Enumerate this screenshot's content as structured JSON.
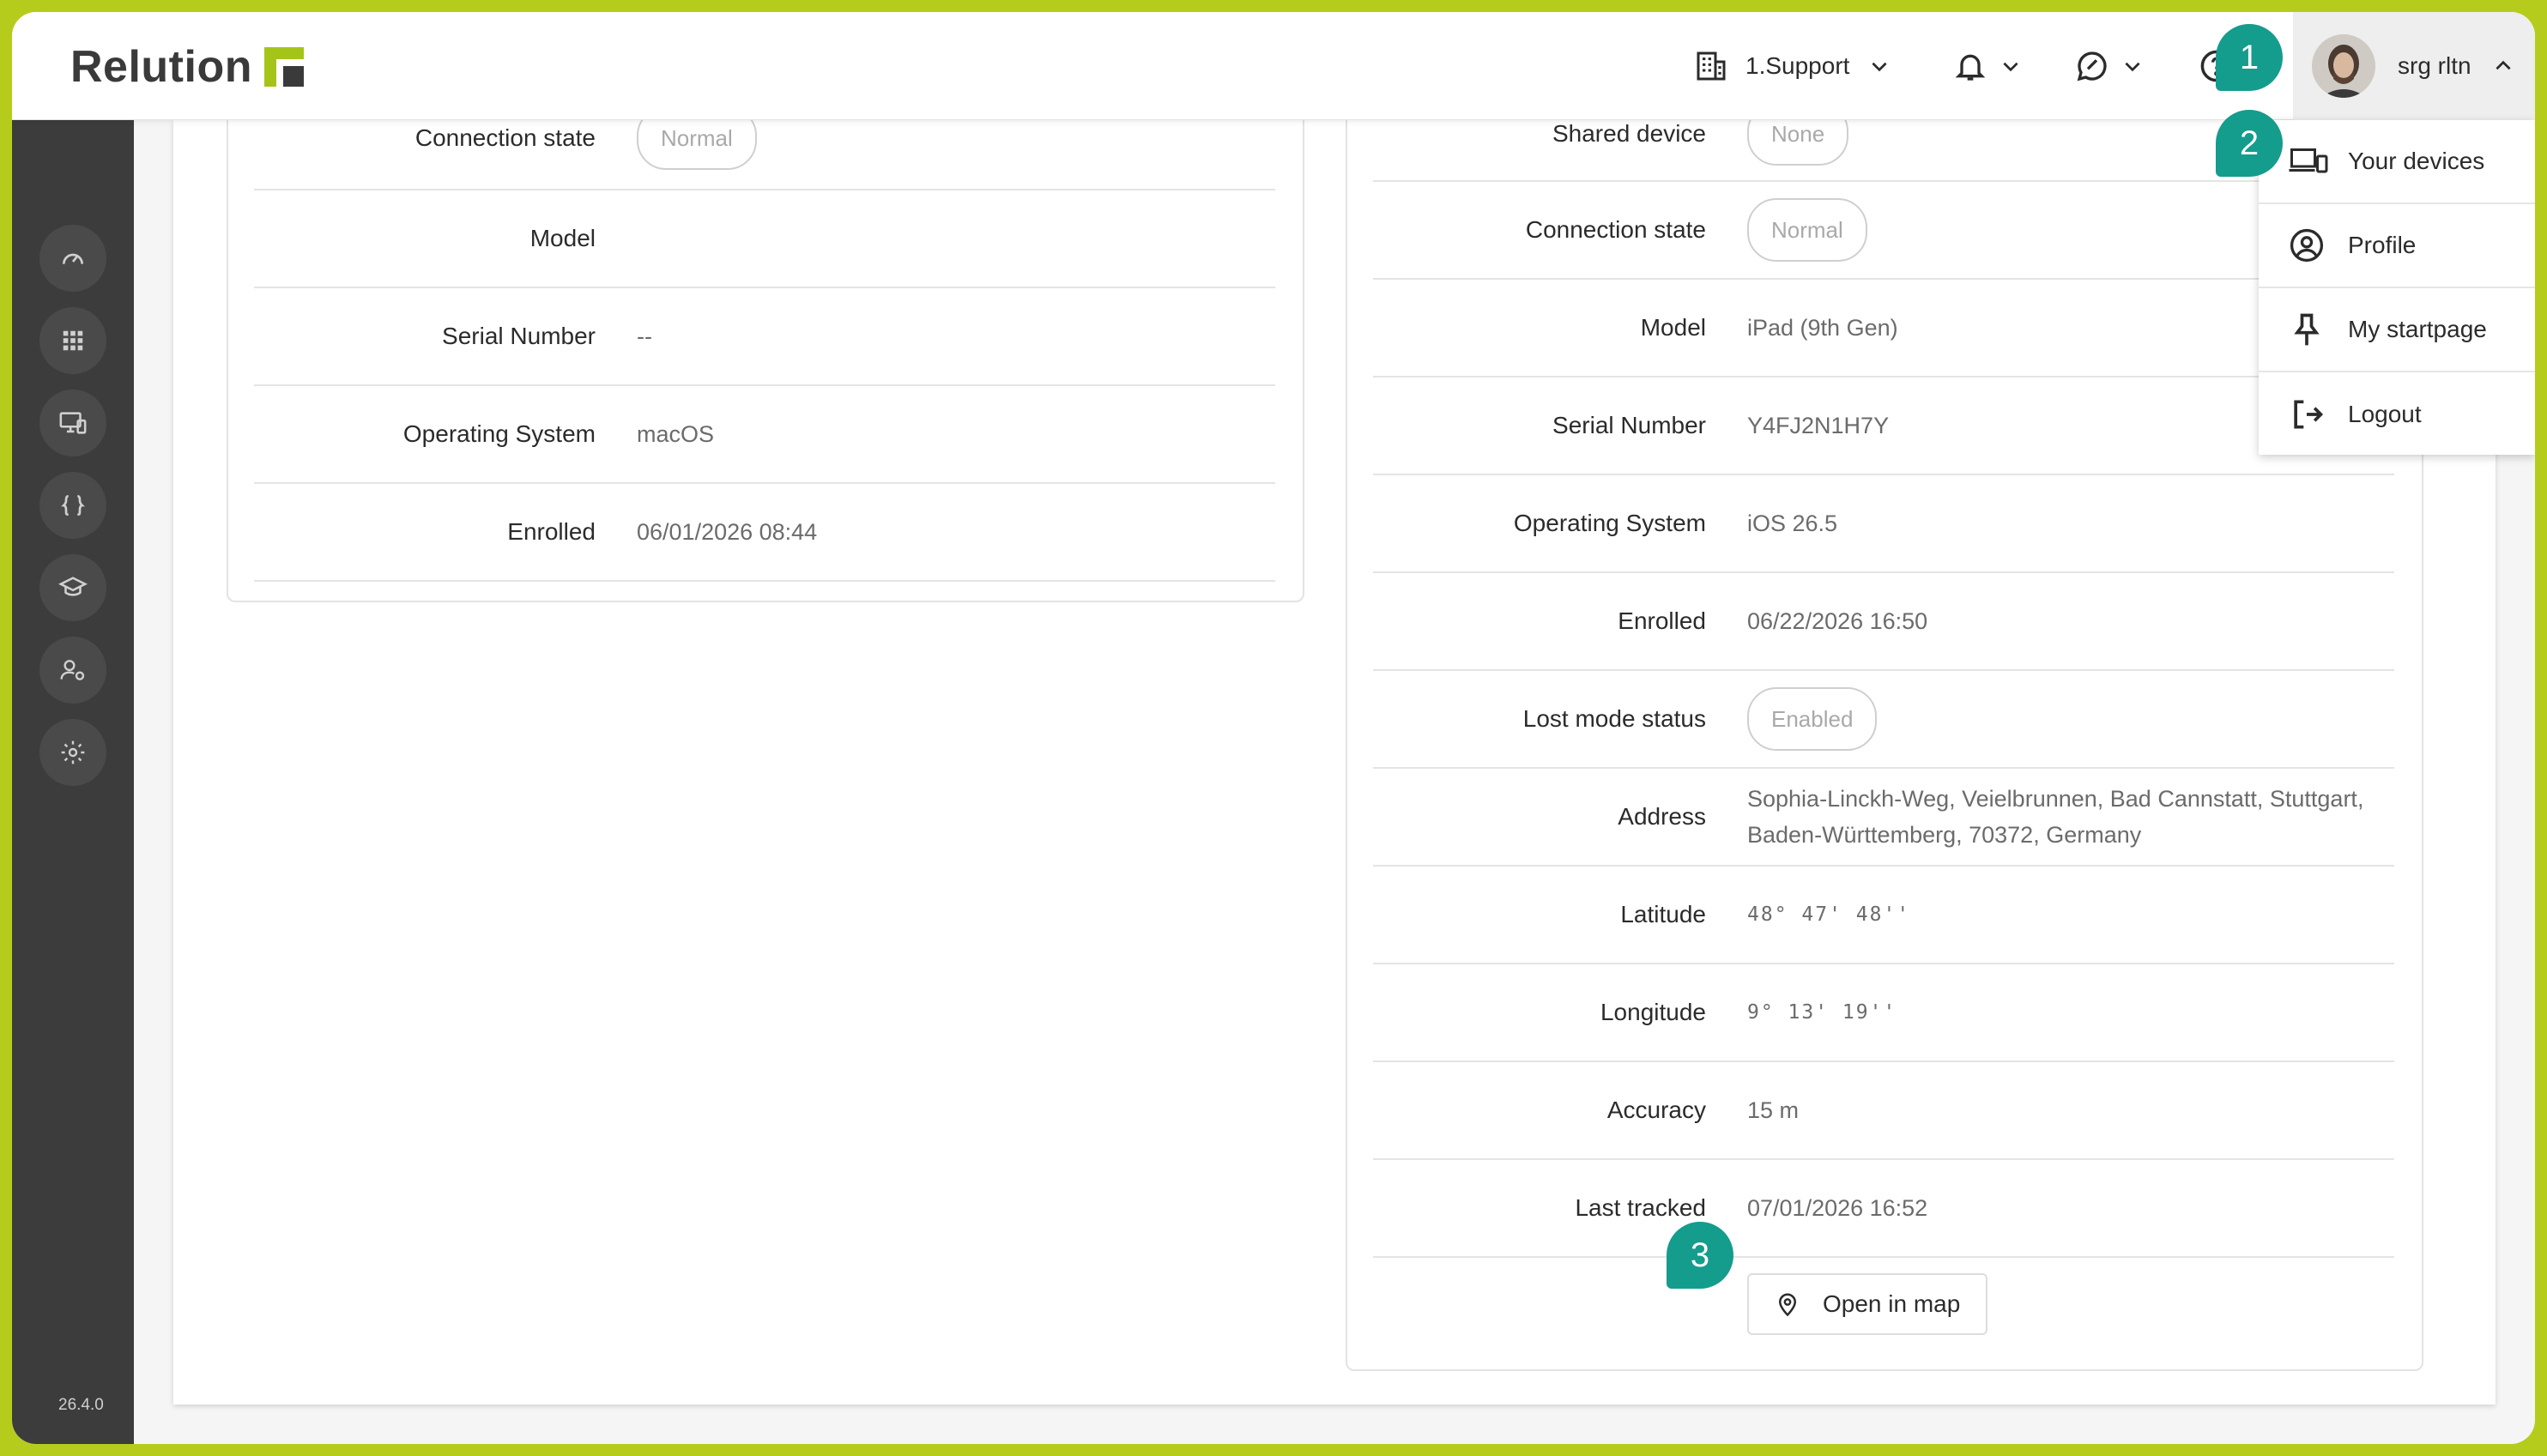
{
  "app": {
    "logo_text": "Relution",
    "version": "26.4.0"
  },
  "header": {
    "organization": "1.Support",
    "user_name": "srg rltn"
  },
  "user_menu": {
    "items": [
      {
        "label": "Your devices",
        "icon": "devices-icon"
      },
      {
        "label": "Profile",
        "icon": "user-circle-icon"
      },
      {
        "label": "My startpage",
        "icon": "pin-icon"
      },
      {
        "label": "Logout",
        "icon": "logout-icon"
      }
    ]
  },
  "sidebar": {
    "items": [
      {
        "icon": "dashboard-icon"
      },
      {
        "icon": "apps-grid-icon"
      },
      {
        "icon": "devices-monitor-icon"
      },
      {
        "icon": "code-braces-icon"
      },
      {
        "icon": "education-icon"
      },
      {
        "icon": "users-settings-icon"
      },
      {
        "icon": "gear-icon"
      }
    ]
  },
  "left_card": {
    "rows": [
      {
        "label": "Connection state",
        "value": "Normal",
        "type": "pill"
      },
      {
        "label": "Model",
        "value": ""
      },
      {
        "label": "Serial Number",
        "value": "--"
      },
      {
        "label": "Operating System",
        "value": "macOS"
      },
      {
        "label": "Enrolled",
        "value": "06/01/2026 08:44"
      }
    ]
  },
  "right_card": {
    "rows": [
      {
        "label": "Shared device",
        "value": "None",
        "type": "pill"
      },
      {
        "label": "Connection state",
        "value": "Normal",
        "type": "pill"
      },
      {
        "label": "Model",
        "value": "iPad (9th Gen)"
      },
      {
        "label": "Serial Number",
        "value": "Y4FJ2N1H7Y"
      },
      {
        "label": "Operating System",
        "value": "iOS 26.5"
      },
      {
        "label": "Enrolled",
        "value": "06/22/2026 16:50"
      },
      {
        "label": "Lost mode status",
        "value": "Enabled",
        "type": "pill"
      },
      {
        "label": "Address",
        "value_line1": "Sophia-Linckh-Weg, Veielbrunnen, Bad Cannstatt, Stuttgart,",
        "value_line2": "Baden-Württemberg, 70372, Germany"
      },
      {
        "label": "Latitude",
        "value": "48° 47' 48''",
        "type": "mono"
      },
      {
        "label": "Longitude",
        "value": "9° 13' 19''",
        "type": "mono"
      },
      {
        "label": "Accuracy",
        "value": "15 m"
      },
      {
        "label": "Last tracked",
        "value": "07/01/2026 16:52"
      }
    ],
    "map_button": "Open in map"
  },
  "callouts": [
    "1",
    "2",
    "3"
  ],
  "colors": {
    "accent": "#b6cc1d",
    "callout": "#149c8c",
    "sidebar": "#3c3c3c"
  }
}
